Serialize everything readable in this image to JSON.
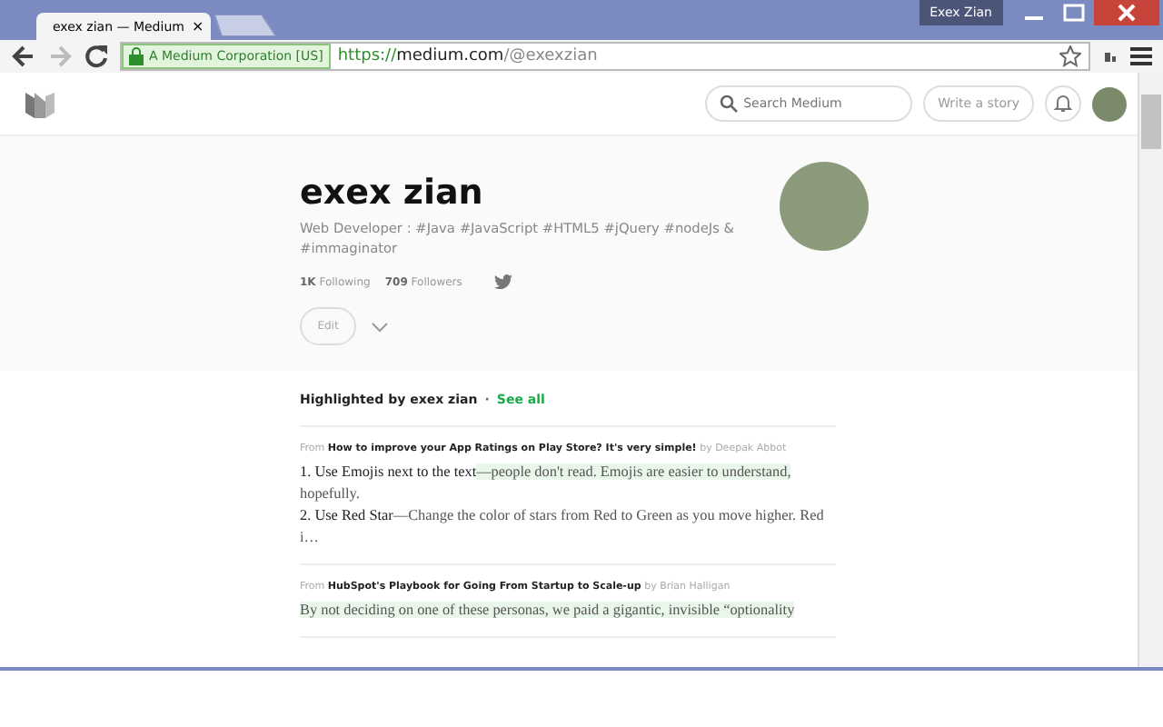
{
  "window": {
    "user": "Exex Zian"
  },
  "tab": {
    "title": "exex zian — Medium",
    "close": "×"
  },
  "toolbar": {
    "forward_disabled": true,
    "security_badge": "A Medium Corporation [US]",
    "url_scheme": "https://",
    "url_host": "medium.com",
    "url_path": "/@exexzian"
  },
  "header": {
    "search": {
      "placeholder": "Search Medium"
    },
    "write_button": "Write a story"
  },
  "profile": {
    "name": "exex zian",
    "bio": "Web Developer : #Java #JavaScript #HTML5 #jQuery #nodeJs & #immaginator",
    "following_count": "1K",
    "following_label": "Following",
    "followers_count": "709",
    "followers_label": "Followers",
    "edit_button": "Edit"
  },
  "highlights": {
    "title": "Highlighted by exex zian",
    "separator": "·",
    "see_all": "See all",
    "items": [
      {
        "from": "From",
        "article": "How to improve your App Ratings on Play Store? It's very simple!",
        "by": "by Deepak Abbot",
        "segments": [
          {
            "text": "1. Use Emojis next to the text",
            "highlighted": false,
            "strong": true
          },
          {
            "text": "—people don't read. Emojis are easier to understand,",
            "highlighted": true,
            "strong": false
          },
          {
            "text": " hopefully.",
            "highlighted": false,
            "strong": false
          },
          {
            "text": "\n2. Use Red Star",
            "highlighted": false,
            "strong": true
          },
          {
            "text": "—Change the color of stars from Red to Green as you move higher. Red i…",
            "highlighted": false,
            "strong": false
          }
        ]
      },
      {
        "from": "From",
        "article": "HubSpot's Playbook for Going From Startup to Scale-up",
        "by": "by Brian Halligan",
        "segments": [
          {
            "text": "By not deciding on one of these personas, we paid a gigantic, invisible “optionality",
            "highlighted": true,
            "strong": false
          }
        ]
      }
    ]
  }
}
